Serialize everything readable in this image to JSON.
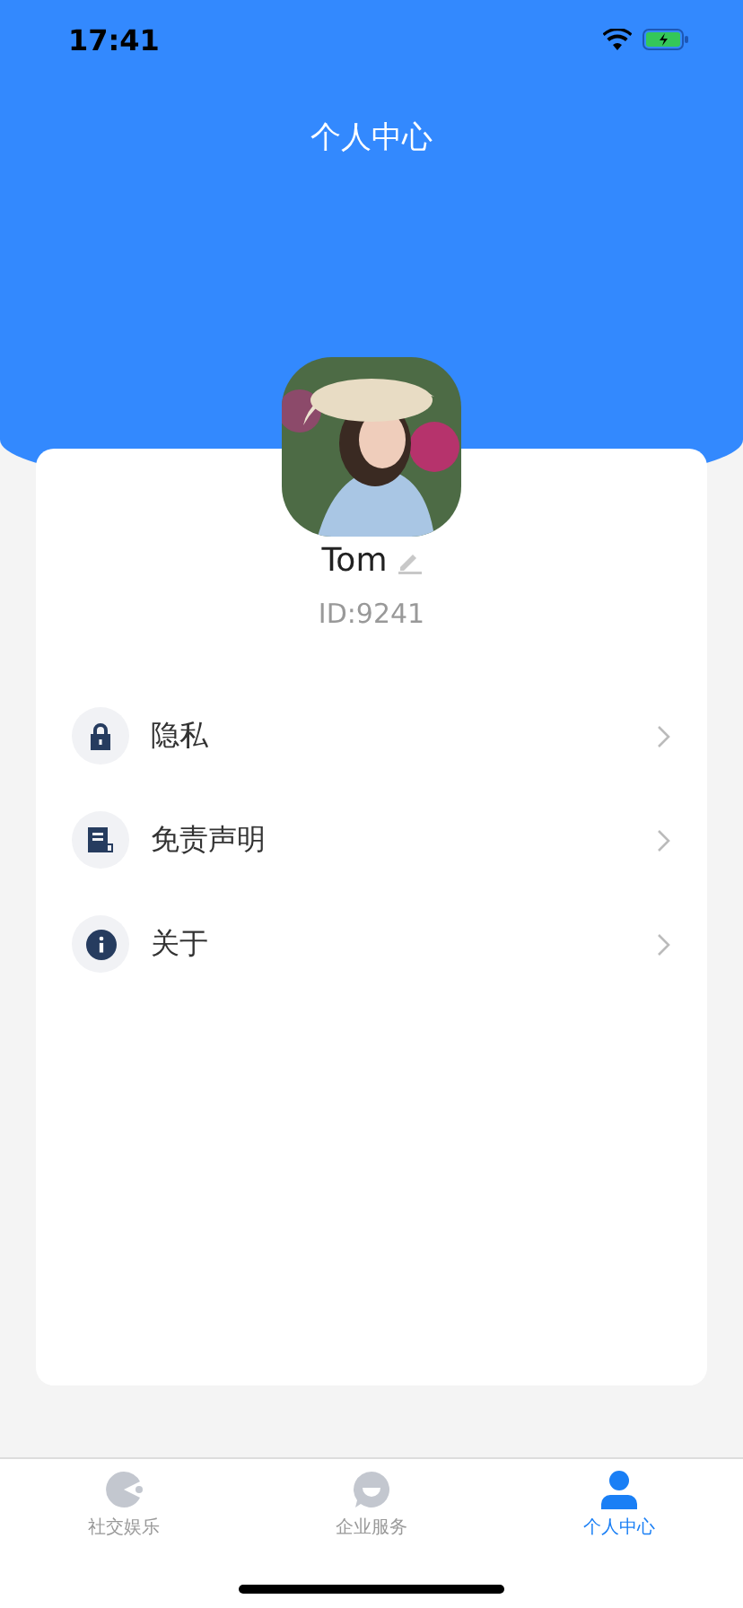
{
  "status_bar": {
    "time": "17:41"
  },
  "header": {
    "title": "个人中心"
  },
  "profile": {
    "name": "Tom",
    "id": "ID:9241"
  },
  "menu": [
    {
      "kind": "lock",
      "label": "隐私"
    },
    {
      "kind": "document",
      "label": "免责声明"
    },
    {
      "kind": "info",
      "label": "关于"
    }
  ],
  "tab_bar": [
    {
      "kind": "game",
      "label": "社交娱乐",
      "selected": false
    },
    {
      "kind": "chat",
      "label": "企业服务",
      "selected": false
    },
    {
      "kind": "person",
      "label": "个人中心",
      "selected": true
    }
  ]
}
